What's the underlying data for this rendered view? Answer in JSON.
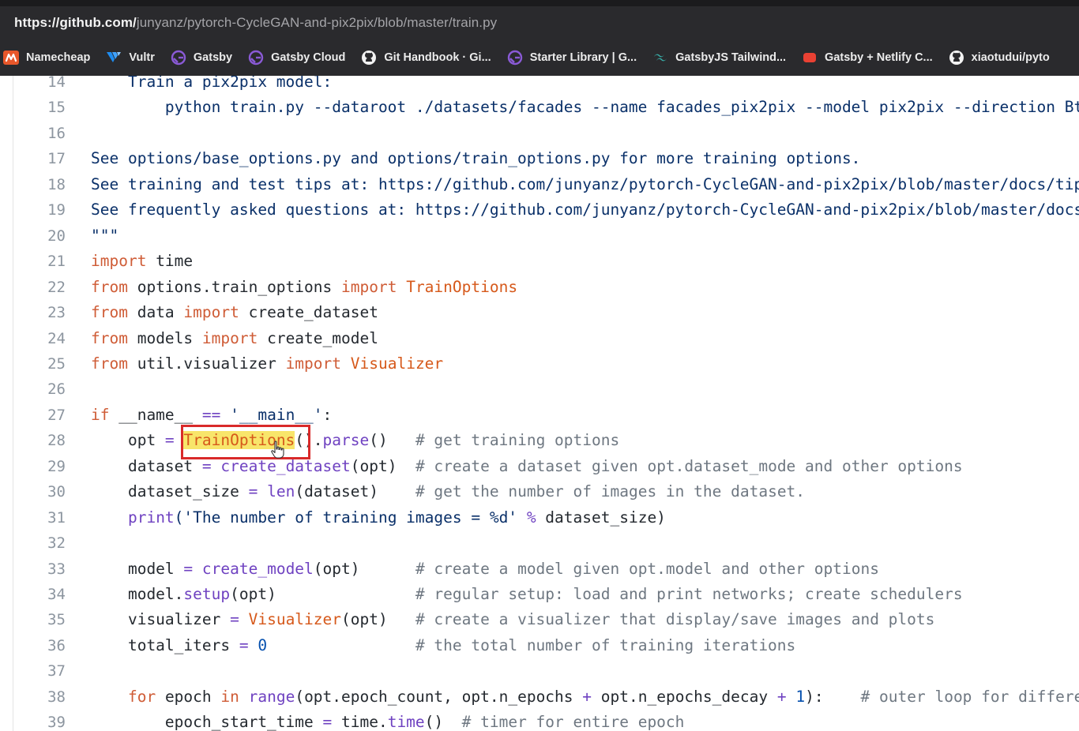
{
  "browser": {
    "url_host": "https://github.com/",
    "url_path": "junyanz/pytorch-CycleGAN-and-pix2pix/blob/master/train.py",
    "bookmarks": [
      {
        "label": "Namecheap",
        "icon": "namecheap-icon"
      },
      {
        "label": "Vultr",
        "icon": "vultr-icon"
      },
      {
        "label": "Gatsby",
        "icon": "gatsby-icon"
      },
      {
        "label": "Gatsby Cloud",
        "icon": "gatsby-icon"
      },
      {
        "label": "Git Handbook · Gi...",
        "icon": "github-icon"
      },
      {
        "label": "Starter Library | G...",
        "icon": "gatsby-icon"
      },
      {
        "label": "GatsbyJS Tailwind...",
        "icon": "tailwind-icon"
      },
      {
        "label": "Gatsby + Netlify C...",
        "icon": "netlify-cms-icon"
      },
      {
        "label": "xiaotudui/pyto",
        "icon": "github-icon"
      }
    ]
  },
  "code": {
    "highlight_term": "TrainOptions",
    "lines": [
      {
        "n": "14",
        "segs": [
          [
            "doc",
            "    Train a pix2pix model:"
          ]
        ]
      },
      {
        "n": "15",
        "segs": [
          [
            "doc",
            "        python train.py --dataroot ./datasets/facades --name facades_pix2pix --model pix2pix --direction BtoA"
          ]
        ]
      },
      {
        "n": "16",
        "segs": []
      },
      {
        "n": "17",
        "segs": [
          [
            "doc",
            "See options/base_options.py and options/train_options.py for more training options."
          ]
        ]
      },
      {
        "n": "18",
        "segs": [
          [
            "doc",
            "See training and test tips at: https://github.com/junyanz/pytorch-CycleGAN-and-pix2pix/blob/master/docs/tips.md"
          ]
        ]
      },
      {
        "n": "19",
        "segs": [
          [
            "doc",
            "See frequently asked questions at: https://github.com/junyanz/pytorch-CycleGAN-and-pix2pix/blob/master/docs/qa.md"
          ]
        ]
      },
      {
        "n": "20",
        "segs": [
          [
            "doc",
            "\"\"\""
          ]
        ]
      },
      {
        "n": "21",
        "segs": [
          [
            "kw",
            "import"
          ],
          [
            "plain",
            " time"
          ]
        ]
      },
      {
        "n": "22",
        "segs": [
          [
            "kw",
            "from"
          ],
          [
            "plain",
            " options.train_options "
          ],
          [
            "kw",
            "import"
          ],
          [
            "plain",
            " "
          ],
          [
            "cls",
            "TrainOptions"
          ]
        ]
      },
      {
        "n": "23",
        "segs": [
          [
            "kw",
            "from"
          ],
          [
            "plain",
            " data "
          ],
          [
            "kw",
            "import"
          ],
          [
            "plain",
            " create_dataset"
          ]
        ]
      },
      {
        "n": "24",
        "segs": [
          [
            "kw",
            "from"
          ],
          [
            "plain",
            " models "
          ],
          [
            "kw",
            "import"
          ],
          [
            "plain",
            " create_model"
          ]
        ]
      },
      {
        "n": "25",
        "segs": [
          [
            "kw",
            "from"
          ],
          [
            "plain",
            " util.visualizer "
          ],
          [
            "kw",
            "import"
          ],
          [
            "plain",
            " "
          ],
          [
            "cls",
            "Visualizer"
          ]
        ]
      },
      {
        "n": "26",
        "segs": []
      },
      {
        "n": "27",
        "segs": [
          [
            "kw",
            "if"
          ],
          [
            "plain",
            " __name__ "
          ],
          [
            "op",
            "=="
          ],
          [
            "plain",
            " "
          ],
          [
            "str",
            "'__main__'"
          ],
          [
            "plain",
            ":"
          ]
        ]
      },
      {
        "n": "28",
        "segs": [
          [
            "plain",
            "    opt "
          ],
          [
            "op",
            "="
          ],
          [
            "plain",
            " "
          ],
          [
            "hl",
            "TrainOptions"
          ],
          [
            "plain",
            "()."
          ],
          [
            "fn",
            "parse"
          ],
          [
            "plain",
            "()   "
          ],
          [
            "cm",
            "# get training options"
          ]
        ]
      },
      {
        "n": "29",
        "segs": [
          [
            "plain",
            "    dataset "
          ],
          [
            "op",
            "="
          ],
          [
            "plain",
            " "
          ],
          [
            "fn",
            "create_dataset"
          ],
          [
            "plain",
            "(opt)  "
          ],
          [
            "cm",
            "# create a dataset given opt.dataset_mode and other options"
          ]
        ]
      },
      {
        "n": "30",
        "segs": [
          [
            "plain",
            "    dataset_size "
          ],
          [
            "op",
            "="
          ],
          [
            "plain",
            " "
          ],
          [
            "fn",
            "len"
          ],
          [
            "plain",
            "(dataset)    "
          ],
          [
            "cm",
            "# get the number of images in the dataset."
          ]
        ]
      },
      {
        "n": "31",
        "segs": [
          [
            "plain",
            "    "
          ],
          [
            "fn",
            "print"
          ],
          [
            "str",
            "('The number of training images = %d'"
          ],
          [
            "plain",
            " "
          ],
          [
            "op",
            "%"
          ],
          [
            "plain",
            " dataset_size)"
          ]
        ]
      },
      {
        "n": "32",
        "segs": []
      },
      {
        "n": "33",
        "segs": [
          [
            "plain",
            "    model "
          ],
          [
            "op",
            "="
          ],
          [
            "plain",
            " "
          ],
          [
            "fn",
            "create_model"
          ],
          [
            "plain",
            "(opt)      "
          ],
          [
            "cm",
            "# create a model given opt.model and other options"
          ]
        ]
      },
      {
        "n": "34",
        "segs": [
          [
            "plain",
            "    model."
          ],
          [
            "fn",
            "setup"
          ],
          [
            "plain",
            "(opt)               "
          ],
          [
            "cm",
            "# regular setup: load and print networks; create schedulers"
          ]
        ]
      },
      {
        "n": "35",
        "segs": [
          [
            "plain",
            "    visualizer "
          ],
          [
            "op",
            "="
          ],
          [
            "plain",
            " "
          ],
          [
            "cls",
            "Visualizer"
          ],
          [
            "plain",
            "(opt)   "
          ],
          [
            "cm",
            "# create a visualizer that display/save images and plots"
          ]
        ]
      },
      {
        "n": "36",
        "segs": [
          [
            "plain",
            "    total_iters "
          ],
          [
            "op",
            "="
          ],
          [
            "plain",
            " "
          ],
          [
            "num",
            "0"
          ],
          [
            "plain",
            "                "
          ],
          [
            "cm",
            "# the total number of training iterations"
          ]
        ]
      },
      {
        "n": "37",
        "segs": []
      },
      {
        "n": "38",
        "segs": [
          [
            "plain",
            "    "
          ],
          [
            "kw",
            "for"
          ],
          [
            "plain",
            " epoch "
          ],
          [
            "kw",
            "in"
          ],
          [
            "plain",
            " "
          ],
          [
            "fn",
            "range"
          ],
          [
            "plain",
            "(opt.epoch_count, opt.n_epochs "
          ],
          [
            "op",
            "+"
          ],
          [
            "plain",
            " opt.n_epochs_decay "
          ],
          [
            "op",
            "+"
          ],
          [
            "plain",
            " "
          ],
          [
            "num",
            "1"
          ],
          [
            "plain",
            "):    "
          ],
          [
            "cm",
            "# outer loop for different epochs"
          ]
        ]
      },
      {
        "n": "39",
        "segs": [
          [
            "plain",
            "        epoch_start_time "
          ],
          [
            "op",
            "="
          ],
          [
            "plain",
            " time."
          ],
          [
            "fn",
            "time"
          ],
          [
            "plain",
            "()  "
          ],
          [
            "cm",
            "# timer for entire epoch"
          ]
        ]
      }
    ]
  }
}
